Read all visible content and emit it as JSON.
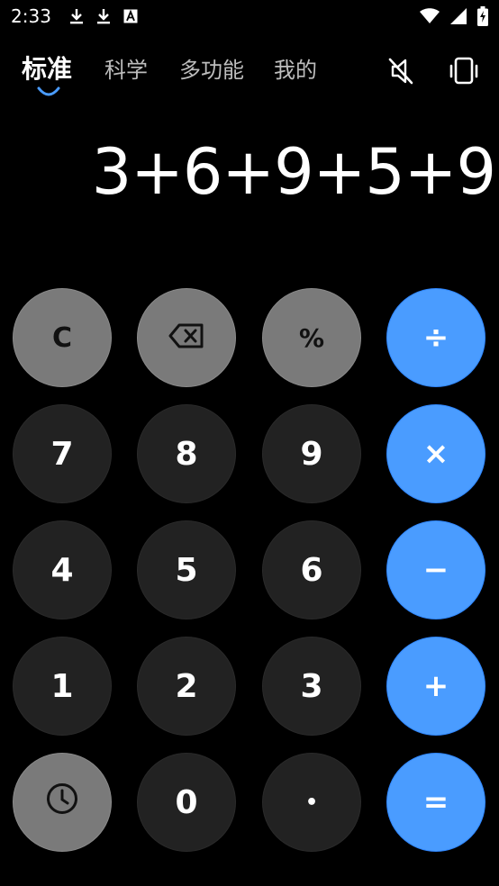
{
  "status_bar": {
    "time": "2:33",
    "left_icons": [
      "download-icon",
      "download-icon",
      "font-a-icon"
    ],
    "right_icons": [
      "wifi-icon",
      "signal-icon",
      "battery-charging-icon"
    ]
  },
  "tabs": [
    {
      "label": "标准",
      "active": true
    },
    {
      "label": "科学",
      "active": false
    },
    {
      "label": "多功能",
      "active": false
    },
    {
      "label": "我的",
      "active": false
    }
  ],
  "toolbar": {
    "mute_icon": "sound-off-icon",
    "vibrate_icon": "vibrate-icon"
  },
  "display": {
    "expression": "3+6+9+5+9"
  },
  "keys": {
    "clear": "C",
    "backspace": "backspace-icon",
    "percent": "%",
    "divide": "÷",
    "seven": "7",
    "eight": "8",
    "nine": "9",
    "multiply": "×",
    "four": "4",
    "five": "5",
    "six": "6",
    "minus": "−",
    "one": "1",
    "two": "2",
    "three": "3",
    "plus": "+",
    "history": "clock-icon",
    "zero": "0",
    "decimal": "•",
    "equals": "="
  },
  "colors": {
    "background": "#000000",
    "digit_key": "#222222",
    "function_key": "#7a7a7a",
    "operator_key": "#4a9cff",
    "accent": "#4a9cff"
  }
}
